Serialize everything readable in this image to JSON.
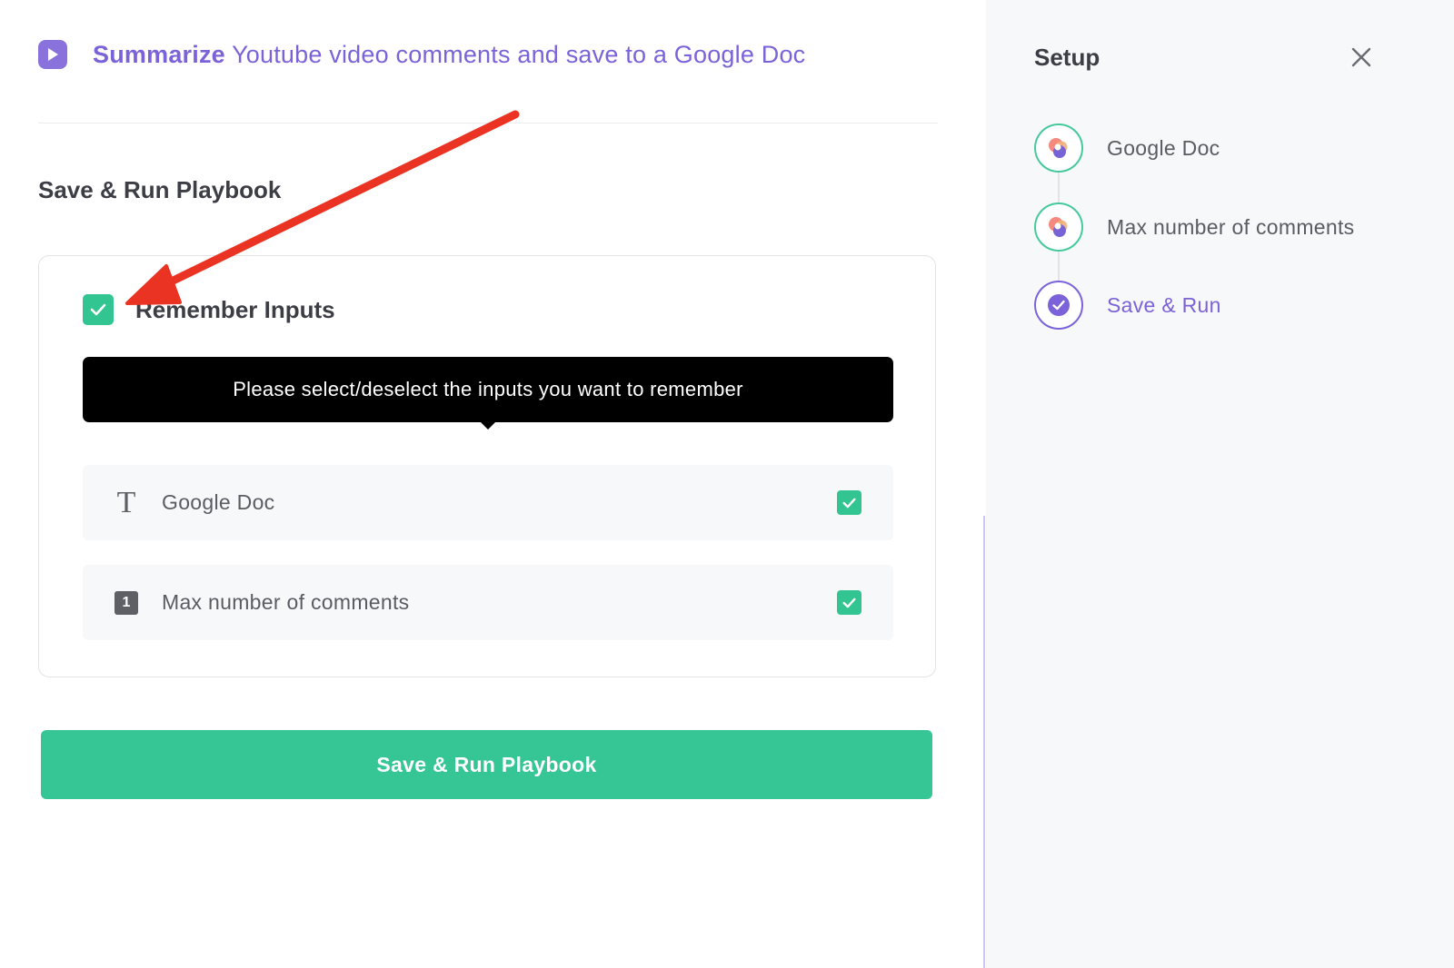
{
  "header": {
    "title_bold": "Summarize",
    "title_rest": " Youtube video comments and save to a Google Doc",
    "icon": "play-icon",
    "accent_color": "#7c62d8"
  },
  "section": {
    "heading": "Save & Run Playbook"
  },
  "remember": {
    "label": "Remember Inputs",
    "checked": true
  },
  "tooltip": {
    "text": "Please select/deselect the inputs you want to remember"
  },
  "inputs": [
    {
      "icon": "text-type-icon",
      "label": "Google Doc",
      "checked": true
    },
    {
      "icon": "number-type-icon",
      "icon_glyph": "1",
      "label": "Max number of comments",
      "checked": true
    }
  ],
  "run_button": {
    "label": "Save & Run Playbook",
    "color": "#36c595"
  },
  "sidebar": {
    "title": "Setup",
    "close_icon": "close-icon",
    "steps": [
      {
        "label": "Google Doc",
        "status": "done",
        "icon": "integration-logo-icon"
      },
      {
        "label": "Max number of comments",
        "status": "done",
        "icon": "integration-logo-icon"
      },
      {
        "label": "Save & Run",
        "status": "active",
        "icon": "check-circle-icon"
      }
    ]
  },
  "annotation": {
    "arrow_color": "#ea3323"
  }
}
